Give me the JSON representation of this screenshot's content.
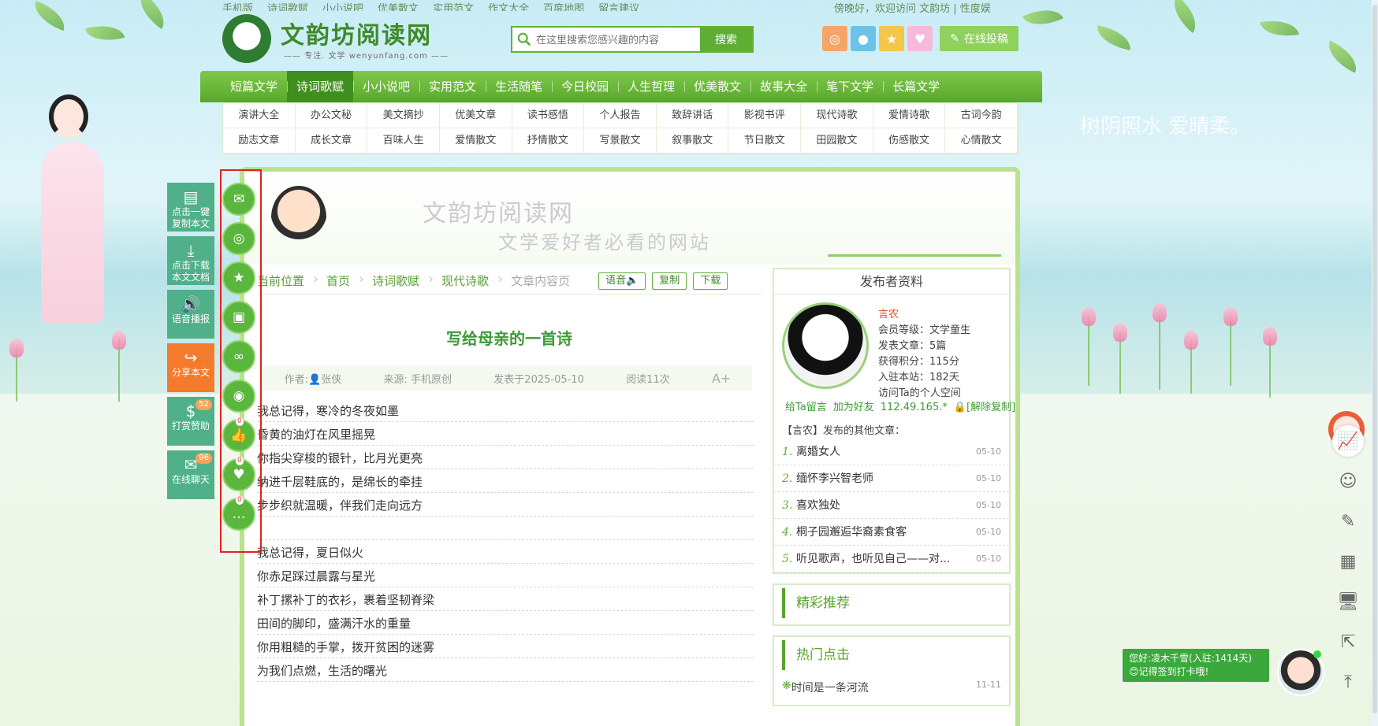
{
  "top_links": [
    "手机版",
    "诗词歌赋",
    "小小说吧",
    "优美散文",
    "实用范文",
    "作文大全",
    "百度地图",
    "留言建议"
  ],
  "top_right": "傍晚好，欢迎访问 文韵坊 | 性度娱",
  "logo": {
    "title": "文韵坊阅读网",
    "subtitle": "—— 专注. 文学 wenyunfang.com ——"
  },
  "search": {
    "placeholder": "在这里搜索您感兴趣的内容",
    "button": "搜索"
  },
  "social_icons": [
    "weibo-icon",
    "qq-icon",
    "star-icon",
    "heart-icon"
  ],
  "submit": "在线投稿",
  "nav": [
    "短篇文学",
    "诗词歌赋",
    "小小说吧",
    "实用范文",
    "生活随笔",
    "今日校园",
    "人生哲理",
    "优美散文",
    "故事大全",
    "笔下文学",
    "长篇文学"
  ],
  "nav_active": 1,
  "subnav": [
    "演讲大全",
    "办公文秘",
    "美文摘抄",
    "优美文章",
    "读书感悟",
    "个人报告",
    "致辞讲话",
    "影视书评",
    "现代诗歌",
    "爱情诗歌",
    "古词今韵",
    "励志文章",
    "成长文章",
    "百味人生",
    "爱情散文",
    "抒情散文",
    "写景散文",
    "叙事散文",
    "节日散文",
    "田园散文",
    "伤感散文",
    "心情散文"
  ],
  "left_toolbar": [
    {
      "icon": "document-icon",
      "label": "点击一键\n复制本文",
      "glyph": "▤"
    },
    {
      "icon": "download-icon",
      "label": "点击下载\n本文文档",
      "glyph": "⤓"
    },
    {
      "icon": "speaker-icon",
      "label": "语音播报",
      "glyph": "🔊"
    },
    {
      "icon": "share-icon",
      "label": "分享本文",
      "glyph": "↪"
    },
    {
      "icon": "money-icon",
      "label": "打赏赞助",
      "glyph": "$",
      "badge": "52"
    },
    {
      "icon": "chat-icon",
      "label": "在线聊天",
      "glyph": "✉",
      "badge": "96"
    }
  ],
  "circle_icons": [
    {
      "icon": "wechat-icon",
      "glyph": "✉"
    },
    {
      "icon": "weibo-icon",
      "glyph": "◎"
    },
    {
      "icon": "star-icon",
      "glyph": "★"
    },
    {
      "icon": "image-icon",
      "glyph": "▣"
    },
    {
      "icon": "link-icon",
      "glyph": "∞"
    },
    {
      "icon": "circle-icon",
      "glyph": "◉"
    },
    {
      "icon": "thumbs-up-icon",
      "glyph": "👍",
      "count": "0"
    },
    {
      "icon": "heart-icon",
      "glyph": "♥",
      "count": "0"
    },
    {
      "icon": "comment-icon",
      "glyph": "…",
      "count": "0"
    }
  ],
  "banner": {
    "title": "文韵坊阅读网",
    "subtitle": "文学爱好者必看的网站"
  },
  "breadcrumb": [
    "当前位置",
    "首页",
    "诗词歌赋",
    "现代诗歌",
    "文章内容页"
  ],
  "actions": [
    "语音🔈",
    "复制",
    "下载"
  ],
  "article": {
    "title": "写给母亲的一首诗",
    "author": "作者:👤张侠",
    "source": "来源: 手机原创",
    "date": "发表于2025-05-10",
    "reads": "阅读11次",
    "font_btn": "A+",
    "lines": [
      "我总记得，寒冷的冬夜如墨",
      "昏黄的油灯在风里摇晃",
      "你指尖穿梭的银针，比月光更亮",
      "纳进千层鞋底的，是绵长的牵挂",
      "步步织就温暖，伴我们走向远方",
      "",
      "我总记得，夏日似火",
      "你赤足踩过晨露与星光",
      "补丁摞补丁的衣衫，裹着坚韧脊梁",
      "田间的脚印，盛满汗水的重量",
      "你用粗糙的手掌，拨开贫困的迷雾",
      "为我们点燃，生活的曙光"
    ]
  },
  "publisher": {
    "head": "发布者资料",
    "name": "言农",
    "level": "会员等级：文学童生",
    "articles": "发表文章：5篇",
    "points": "获得积分：115分",
    "days": "入驻本站：182天",
    "space": "访问Ta的个人空间",
    "links": [
      "给Ta留言",
      "加为好友",
      "112.49.165.*",
      "🔒[解除复制]"
    ],
    "others_title": "【言农】发布的其他文章：",
    "others": [
      {
        "n": "1.",
        "t": "离婚女人",
        "d": "05-10"
      },
      {
        "n": "2.",
        "t": "缅怀李兴智老师",
        "d": "05-10"
      },
      {
        "n": "3.",
        "t": "喜欢独处",
        "d": "05-10"
      },
      {
        "n": "4.",
        "t": "桐子园邂逅华裔素食客",
        "d": "05-10"
      },
      {
        "n": "5.",
        "t": "听见歌声，也听见自己——对...",
        "d": "05-10"
      }
    ]
  },
  "recommend_head": "精彩推荐",
  "hot_head": "热门点击",
  "hot_items": [
    {
      "t": "时间是一条河流",
      "d": "11-11"
    }
  ],
  "right_col": [
    "chart-icon",
    "smile-icon",
    "edit-icon",
    "qrcode-icon",
    "monitor-icon",
    "share-icon",
    "back-to-top-icon"
  ],
  "welcome": {
    "line1": "您好:凌木千雪(入驻:1414天)",
    "line2": "😊记得签到打卡哦!"
  },
  "slogan": "树阴照水 爱晴柔。",
  "colors": {
    "primary": "#58a72d",
    "accent": "#3d9a3a",
    "highlight": "#e0221f"
  }
}
